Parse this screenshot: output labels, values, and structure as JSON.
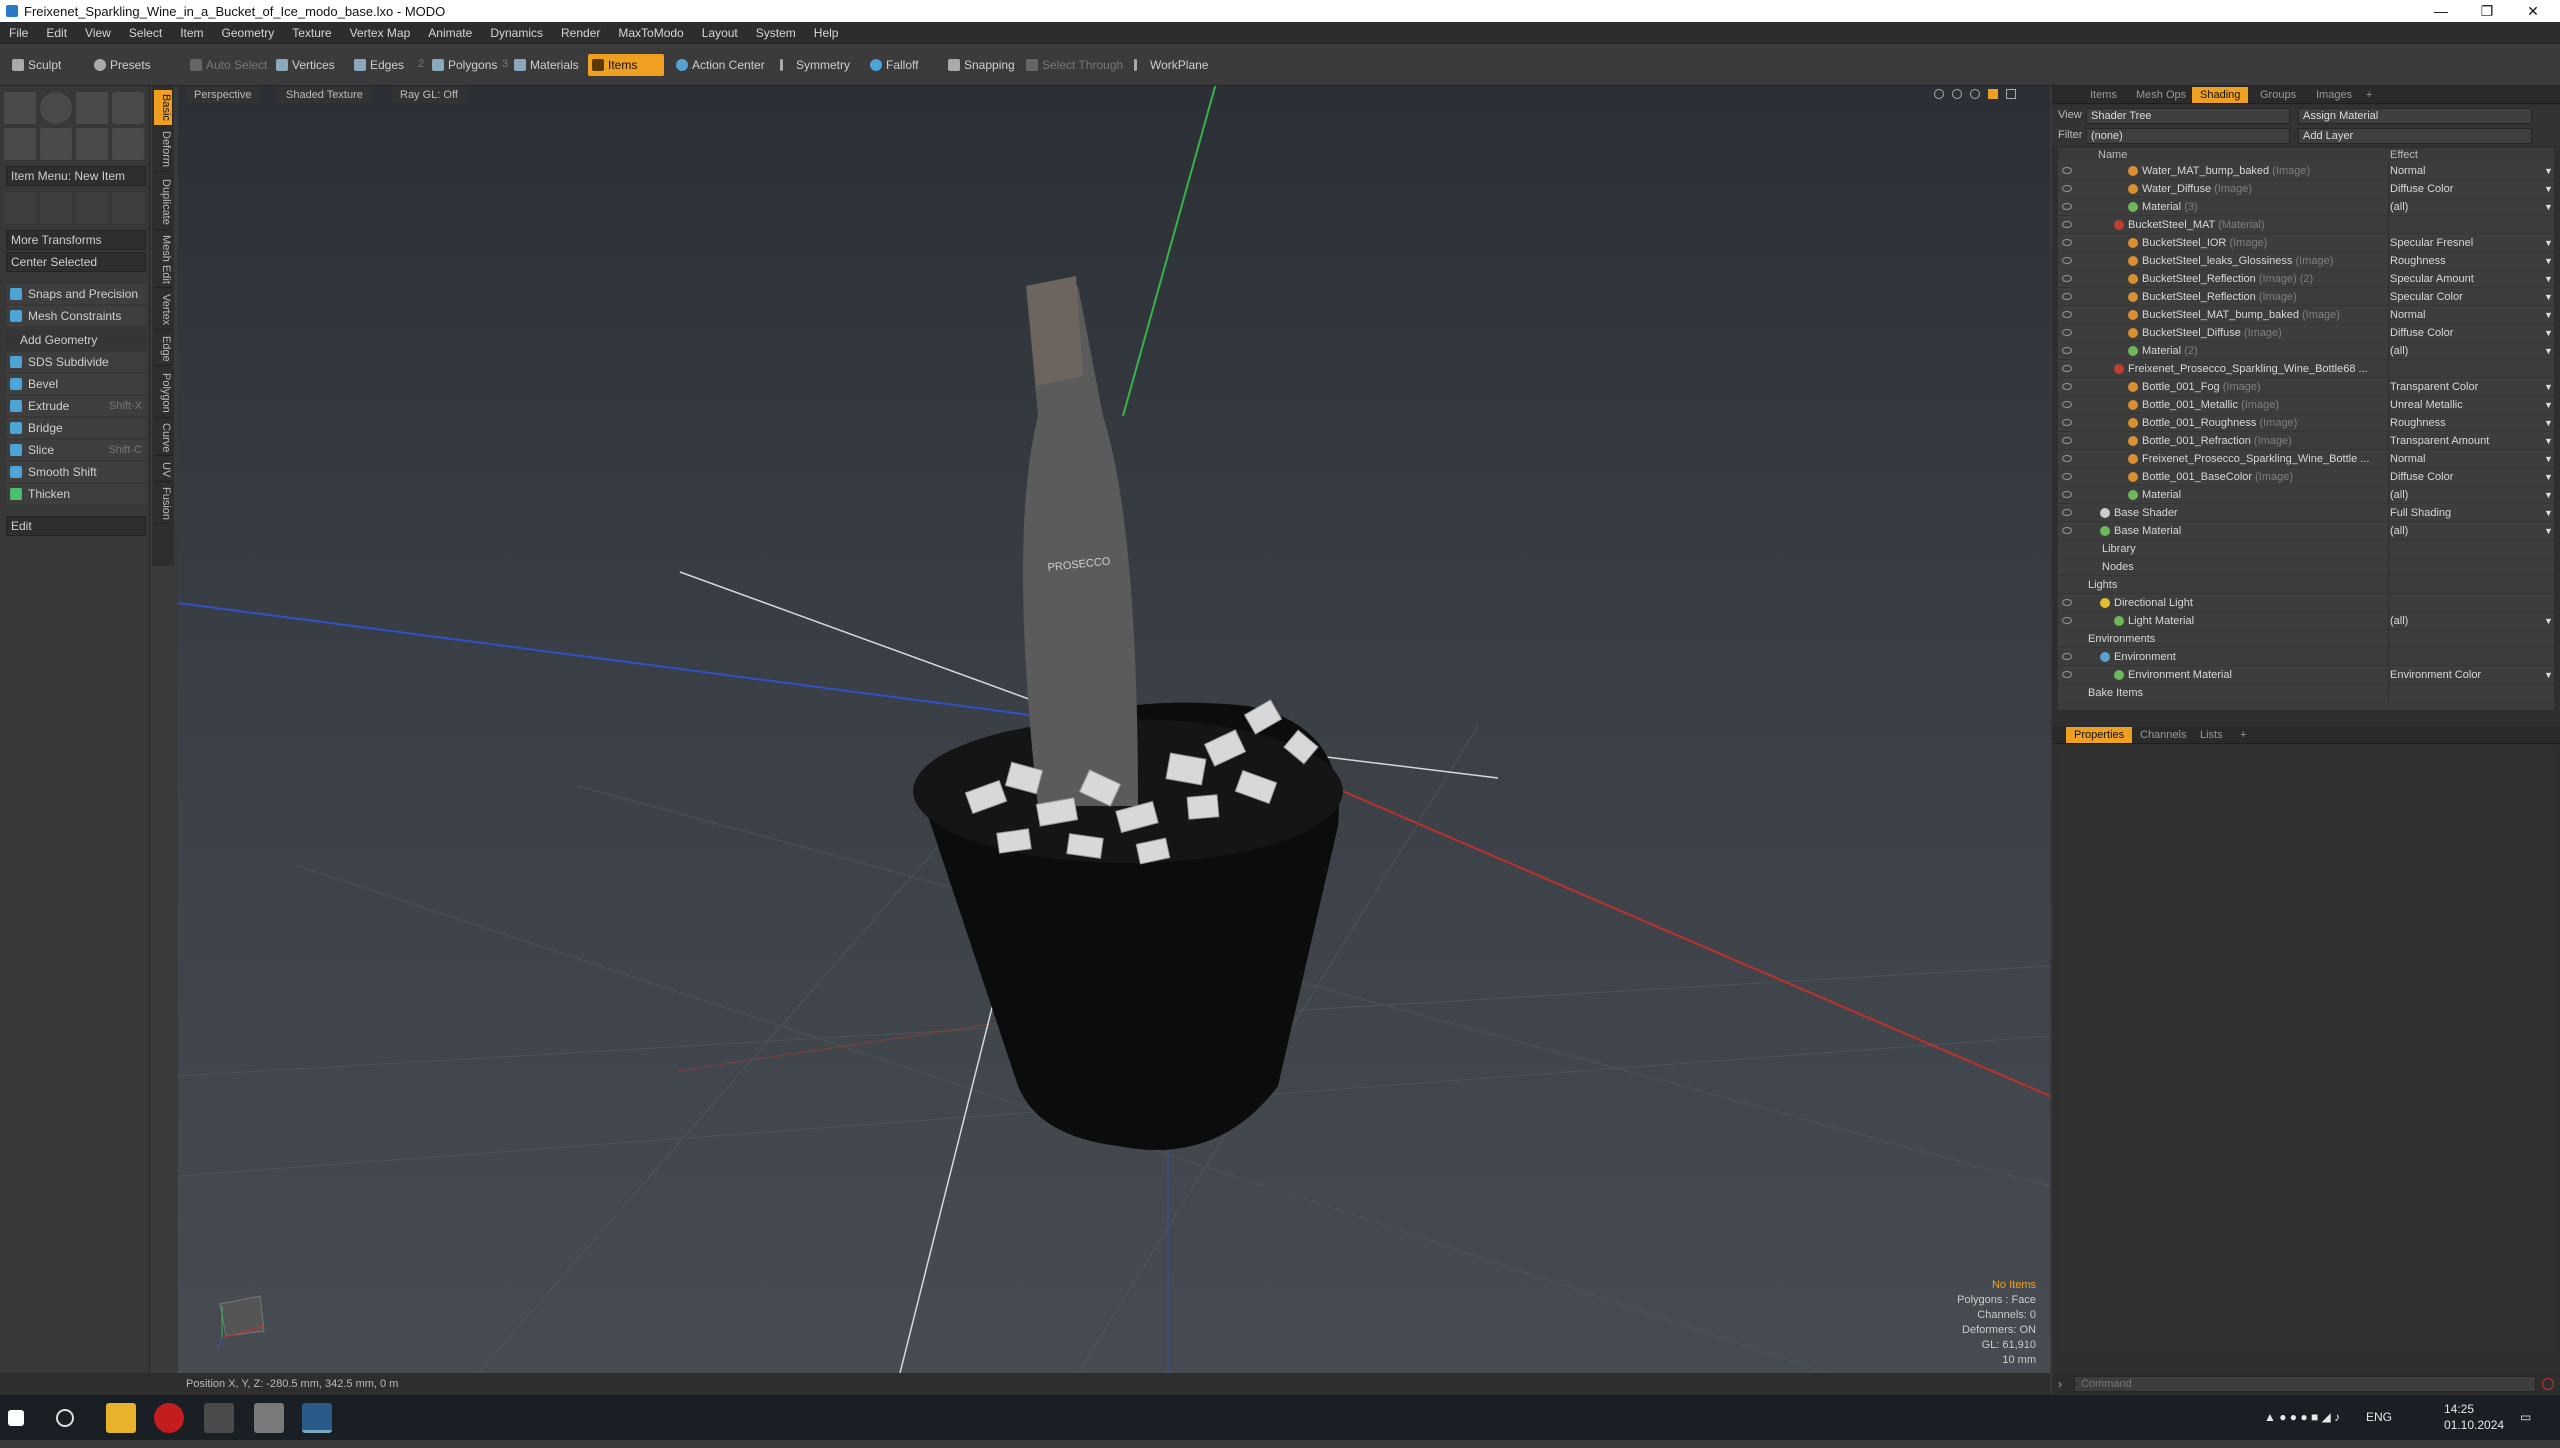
{
  "window": {
    "title": "Freixenet_Sparkling_Wine_in_a_Bucket_of_Ice_modo_base.lxo - MODO",
    "controls": [
      "—",
      "❐",
      "✕"
    ]
  },
  "menu": [
    "File",
    "Edit",
    "View",
    "Select",
    "Item",
    "Geometry",
    "Texture",
    "Vertex Map",
    "Animate",
    "Dynamics",
    "Render",
    "MaxToModo",
    "Layout",
    "System",
    "Help"
  ],
  "toolbar": {
    "sculpt": "Sculpt",
    "presets": "Presets",
    "auto_select": "Auto Select",
    "vertices": "Vertices",
    "edges": "Edges",
    "polygons": "Polygons",
    "materials": "Materials",
    "items": "Items",
    "action_center": "Action Center",
    "symmetry": "Symmetry",
    "falloff": "Falloff",
    "snapping": "Snapping",
    "select_through": "Select Through",
    "workplane": "WorkPlane",
    "hotkey_2": "2",
    "hotkey_3": "3"
  },
  "lefttools": {
    "item_menu": "Item Menu: New Item",
    "more_transforms": "More Transforms",
    "center_selected": "Center Selected",
    "snaps": "Snaps and Precision",
    "mesh_constraints": "Mesh Constraints",
    "add_geometry": "Add Geometry",
    "tools": [
      {
        "label": "SDS Subdivide",
        "shortcut": ""
      },
      {
        "label": "Bevel",
        "shortcut": ""
      },
      {
        "label": "Extrude",
        "shortcut": "Shift-X"
      },
      {
        "label": "Bridge",
        "shortcut": ""
      },
      {
        "label": "Slice",
        "shortcut": "Shift-C"
      },
      {
        "label": "Smooth Shift",
        "shortcut": ""
      },
      {
        "label": "Thicken",
        "shortcut": ""
      }
    ],
    "edit": "Edit",
    "vtabs": [
      "Basic",
      "Deform",
      "Duplicate",
      "Mesh Edit",
      "Vertex",
      "Edge",
      "Polygon",
      "Curve",
      "UV",
      "Fusion"
    ]
  },
  "viewport": {
    "perspective": "Perspective",
    "shading": "Shaded Texture",
    "raygl": "Ray GL: Off",
    "info": {
      "no_items": "No Items",
      "polygons": "Polygons : Face",
      "channels": "Channels: 0",
      "deformers": "Deformers: ON",
      "gl": "GL: 61,910",
      "scale": "10 mm"
    },
    "label_text": "PROSECCO"
  },
  "status": {
    "position": "Position X, Y, Z:  -280.5 mm, 342.5 mm, 0 m"
  },
  "rightpanel": {
    "top_tabs": [
      "Items",
      "Mesh Ops",
      "Shading",
      "Groups",
      "Images",
      "+"
    ],
    "view_label": "View",
    "view_value": "Shader Tree",
    "assign_material": "Assign Material",
    "filter_label": "Filter",
    "filter_value": "(none)",
    "add_layer": "Add Layer",
    "col_name": "Name",
    "col_effect": "Effect",
    "rows": [
      {
        "name": "Water_MAT_bump_baked",
        "type": "(Image)",
        "effect": "Normal",
        "indent": 3,
        "kind": "img"
      },
      {
        "name": "Water_Diffuse",
        "type": "(Image)",
        "effect": "Diffuse Color",
        "indent": 3,
        "kind": "img"
      },
      {
        "name": "Material",
        "type": "(3)",
        "effect": "(all)",
        "indent": 3,
        "kind": "mat"
      },
      {
        "name": "BucketSteel_MAT",
        "type": "(Material)",
        "effect": "",
        "indent": 2,
        "kind": "grp"
      },
      {
        "name": "BucketSteel_IOR",
        "type": "(Image)",
        "effect": "Specular Fresnel",
        "indent": 3,
        "kind": "img"
      },
      {
        "name": "BucketSteel_leaks_Glossiness",
        "type": "(Image)",
        "effect": "Roughness",
        "indent": 3,
        "kind": "img"
      },
      {
        "name": "BucketSteel_Reflection",
        "type": "(Image) (2)",
        "effect": "Specular Amount",
        "indent": 3,
        "kind": "img"
      },
      {
        "name": "BucketSteel_Reflection",
        "type": "(Image)",
        "effect": "Specular Color",
        "indent": 3,
        "kind": "img"
      },
      {
        "name": "BucketSteel_MAT_bump_baked",
        "type": "(Image)",
        "effect": "Normal",
        "indent": 3,
        "kind": "img"
      },
      {
        "name": "BucketSteel_Diffuse",
        "type": "(Image)",
        "effect": "Diffuse Color",
        "indent": 3,
        "kind": "img"
      },
      {
        "name": "Material",
        "type": "(2)",
        "effect": "(all)",
        "indent": 3,
        "kind": "mat"
      },
      {
        "name": "Freixenet_Prosecco_Sparkling_Wine_Bottle68 ...",
        "type": "",
        "effect": "",
        "indent": 2,
        "kind": "grp"
      },
      {
        "name": "Bottle_001_Fog",
        "type": "(Image)",
        "effect": "Transparent Color",
        "indent": 3,
        "kind": "img"
      },
      {
        "name": "Bottle_001_Metallic",
        "type": "(Image)",
        "effect": "Unreal Metallic",
        "indent": 3,
        "kind": "img"
      },
      {
        "name": "Bottle_001_Roughness",
        "type": "(Image)",
        "effect": "Roughness",
        "indent": 3,
        "kind": "img"
      },
      {
        "name": "Bottle_001_Refraction",
        "type": "(Image)",
        "effect": "Transparent Amount",
        "indent": 3,
        "kind": "img"
      },
      {
        "name": "Freixenet_Prosecco_Sparkling_Wine_Bottle ...",
        "type": "",
        "effect": "Normal",
        "indent": 3,
        "kind": "img"
      },
      {
        "name": "Bottle_001_BaseColor",
        "type": "(Image)",
        "effect": "Diffuse Color",
        "indent": 3,
        "kind": "img"
      },
      {
        "name": "Material",
        "type": "",
        "effect": "(all)",
        "indent": 3,
        "kind": "mat"
      },
      {
        "name": "Base Shader",
        "type": "",
        "effect": "Full Shading",
        "indent": 1,
        "kind": "shd"
      },
      {
        "name": "Base Material",
        "type": "",
        "effect": "(all)",
        "indent": 1,
        "kind": "mat"
      },
      {
        "name": "Library",
        "type": "",
        "effect": "",
        "indent": 1,
        "kind": "fold"
      },
      {
        "name": "Nodes",
        "type": "",
        "effect": "",
        "indent": 1,
        "kind": "fold"
      },
      {
        "name": "Lights",
        "type": "",
        "effect": "",
        "indent": 0,
        "kind": "none"
      },
      {
        "name": "Directional Light",
        "type": "",
        "effect": "",
        "indent": 1,
        "kind": "light"
      },
      {
        "name": "Light Material",
        "type": "",
        "effect": "(all)",
        "indent": 2,
        "kind": "mat"
      },
      {
        "name": "Environments",
        "type": "",
        "effect": "",
        "indent": 0,
        "kind": "none"
      },
      {
        "name": "Environment",
        "type": "",
        "effect": "",
        "indent": 1,
        "kind": "env"
      },
      {
        "name": "Environment Material",
        "type": "",
        "effect": "Environment Color",
        "indent": 2,
        "kind": "mat"
      },
      {
        "name": "Bake Items",
        "type": "",
        "effect": "",
        "indent": 0,
        "kind": "none"
      }
    ],
    "bottom_tabs": [
      "Properties",
      "Channels",
      "Lists",
      "+"
    ],
    "command_placeholder": "Command"
  },
  "taskbar": {
    "lang": "ENG",
    "time": "14:25",
    "date": "01.10.2024"
  },
  "colors": {
    "accent": "#f0a020",
    "x_axis": "#c0302a",
    "y_axis": "#37b34a",
    "z_axis": "#3050c8"
  }
}
